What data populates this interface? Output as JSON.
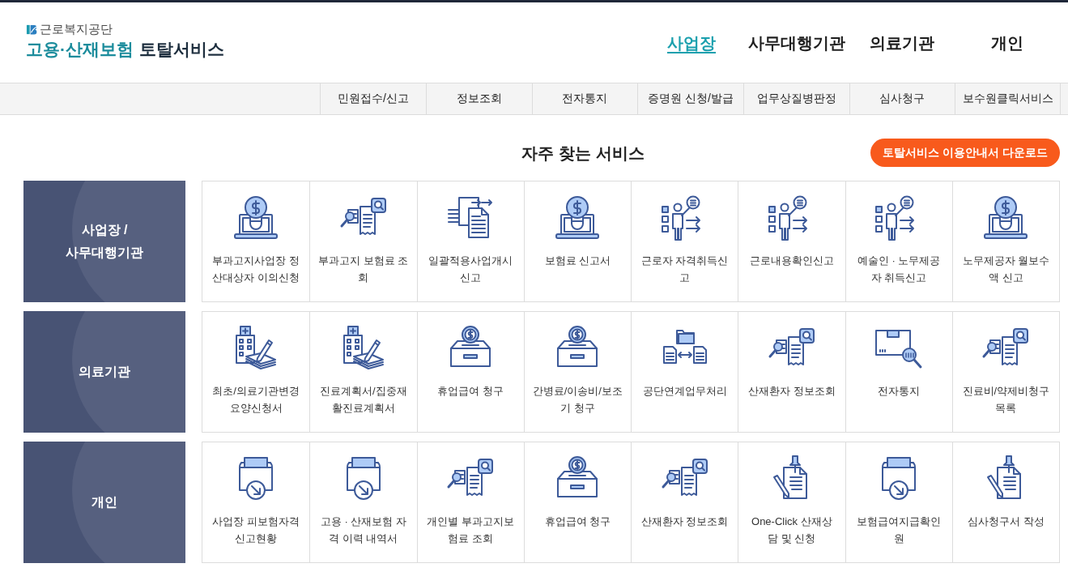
{
  "header": {
    "org_name": "근로복지공단",
    "insurance_name": "고용·산재보험",
    "service_name": "토탈서비스"
  },
  "main_nav": [
    {
      "label": "사업장",
      "selected": true
    },
    {
      "label": "사무대행기관",
      "selected": false
    },
    {
      "label": "의료기관",
      "selected": false
    },
    {
      "label": "개인",
      "selected": false
    }
  ],
  "sub_nav": [
    "민원접수/신고",
    "정보조회",
    "전자통지",
    "증명원 신청/발급",
    "업무상질병판정",
    "심사청구",
    "보수원클릭서비스"
  ],
  "section_title": "자주 찾는 서비스",
  "download_button": "토탈서비스 이용안내서 다운로드",
  "groups": [
    {
      "label": "사업장 / 사무대행기관",
      "services": [
        {
          "label": "부과고지사업장 정산대상자 이의신청",
          "kind": "bulb"
        },
        {
          "label": "부과고지 보험료 조회",
          "kind": "receipt"
        },
        {
          "label": "일괄적용사업개시신고",
          "kind": "transfer"
        },
        {
          "label": "보험료 신고서",
          "kind": "bulb"
        },
        {
          "label": "근로자 자격취득신고",
          "kind": "presenter"
        },
        {
          "label": "근로내용확인신고",
          "kind": "presenter"
        },
        {
          "label": "예술인 · 노무제공자 취득신고",
          "kind": "presenter"
        },
        {
          "label": "노무제공자 월보수액 신고",
          "kind": "bulb"
        }
      ]
    },
    {
      "label": "의료기관",
      "services": [
        {
          "label": "최초/의료기관변경 요양신청서",
          "kind": "hospital"
        },
        {
          "label": "진료계획서/집중재활진료계획서",
          "kind": "hospital"
        },
        {
          "label": "휴업급여 청구",
          "kind": "coinbox"
        },
        {
          "label": "간병료/이송비/보조기 청구",
          "kind": "coinbox"
        },
        {
          "label": "공단연계업무처리",
          "kind": "exchange"
        },
        {
          "label": "산재환자 정보조회",
          "kind": "receipt"
        },
        {
          "label": "전자통지",
          "kind": "parcel"
        },
        {
          "label": "진료비/약제비청구목록",
          "kind": "receipt"
        }
      ]
    },
    {
      "label": "개인",
      "services": [
        {
          "label": "사업장 피보험자격 신고현황",
          "kind": "tray"
        },
        {
          "label": "고용 · 산재보험 자격 이력 내역서",
          "kind": "tray"
        },
        {
          "label": "개인별 부과고지보험료 조회",
          "kind": "receipt"
        },
        {
          "label": "휴업급여 청구",
          "kind": "coinbox"
        },
        {
          "label": "산재환자 정보조회",
          "kind": "receipt"
        },
        {
          "label": "One-Click 산재상담 및 신청",
          "kind": "pinned"
        },
        {
          "label": "보험급여지급확인원",
          "kind": "tray"
        },
        {
          "label": "심사청구서 작성",
          "kind": "pinned"
        }
      ]
    }
  ]
}
